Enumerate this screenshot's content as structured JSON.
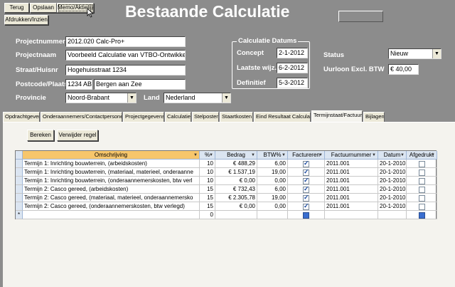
{
  "toolbar": {
    "terug": "Terug",
    "opslaan": "Opslaan",
    "memo": "Memo/Aktielijst",
    "afdrukken": "Afdrukken/Inzien"
  },
  "page_title": "Bestaande Calculatie",
  "form": {
    "projectnummer_label": "Projectnummer",
    "projectnummer_value": "2012.020 Calc-Pro+",
    "projectnaam_label": "Projectnaam",
    "projectnaam_value": "Voorbeeld Calculatie van VTBO-Ontwikkeling",
    "straat_label": "Straat/Huisnr",
    "straat_value": "Hogehuisstraat 1234",
    "postcode_label": "Postcode/Plaats",
    "postcode_value": "1234 AB",
    "plaats_value": "Bergen aan Zee",
    "provincie_label": "Provincie",
    "provincie_value": "Noord-Brabant",
    "land_label": "Land",
    "land_value": "Nederland"
  },
  "dates": {
    "group_title": "Calculatie Datums",
    "concept_label": "Concept",
    "concept_value": "2-1-2012",
    "laatste_label": "Laatste wijz.",
    "laatste_value": "6-2-2012",
    "definitief_label": "Definitief",
    "definitief_value": "5-3-2012"
  },
  "status": {
    "status_label": "Status",
    "status_value": "Nieuw",
    "uurloon_label": "Uurloon Excl. BTW",
    "uurloon_value": "€ 40,00"
  },
  "tabs": [
    {
      "label": "Opdrachtgever"
    },
    {
      "label": "Onderaannemers/Contactpersonen"
    },
    {
      "label": "Projectgegevens"
    },
    {
      "label": "Calculatie"
    },
    {
      "label": "Stelposten"
    },
    {
      "label": "Staartkosten"
    },
    {
      "label": "Eind Resultaat Calculatie"
    },
    {
      "label": "Termijnstaat/Factuur"
    },
    {
      "label": "Bijlagen"
    }
  ],
  "actions": {
    "bereken": "Bereken",
    "verwijder": "Verwijder regel"
  },
  "table": {
    "columns": [
      "Omschrijving",
      "%",
      "Bedrag",
      "BTW%",
      "Factureren",
      "Factuurnummer",
      "Datum",
      "Afgedrukt"
    ],
    "rows": [
      {
        "omschrijving": "Termijn 1: Inrichting bouwterrein, (arbeidskosten)",
        "pct": "10",
        "bedrag": "€ 488,29",
        "btw": "6,00",
        "factureren": true,
        "factuurnummer": "2011.001",
        "datum": "20-1-2010",
        "afgedrukt": false
      },
      {
        "omschrijving": "Termijn 1: Inrichting bouwterrein, (materiaal, materieel, onderaanne",
        "pct": "10",
        "bedrag": "€ 1.537,19",
        "btw": "19,00",
        "factureren": true,
        "factuurnummer": "2011.001",
        "datum": "20-1-2010",
        "afgedrukt": false
      },
      {
        "omschrijving": "Termijn 1: Inrichting bouwterrein, (onderaannemerskosten, btw verl",
        "pct": "10",
        "bedrag": "€ 0,00",
        "btw": "0,00",
        "factureren": true,
        "factuurnummer": "2011.001",
        "datum": "20-1-2010",
        "afgedrukt": false
      },
      {
        "omschrijving": "Termijn 2: Casco gereed, (arbeidskosten)",
        "pct": "15",
        "bedrag": "€ 732,43",
        "btw": "6,00",
        "factureren": true,
        "factuurnummer": "2011.001",
        "datum": "20-1-2010",
        "afgedrukt": false
      },
      {
        "omschrijving": "Termijn 2: Casco gereed, (materiaal, materieel, onderaannemersko",
        "pct": "15",
        "bedrag": "€ 2.305,78",
        "btw": "19,00",
        "factureren": true,
        "factuurnummer": "2011.001",
        "datum": "20-1-2010",
        "afgedrukt": false
      },
      {
        "omschrijving": "Termijn 2: Casco gereed, (onderaannemerskosten, btw verlegd)",
        "pct": "15",
        "bedrag": "€ 0,00",
        "btw": "0,00",
        "factureren": true,
        "factuurnummer": "2011.001",
        "datum": "20-1-2010",
        "afgedrukt": false
      }
    ],
    "new_row_marker": "*",
    "new_row_pct": "0"
  },
  "colors": {
    "background": "#8c8c8c",
    "panel": "#f4f3ee",
    "header": "#dbe5f1",
    "header_selected": "#f7c66b"
  }
}
